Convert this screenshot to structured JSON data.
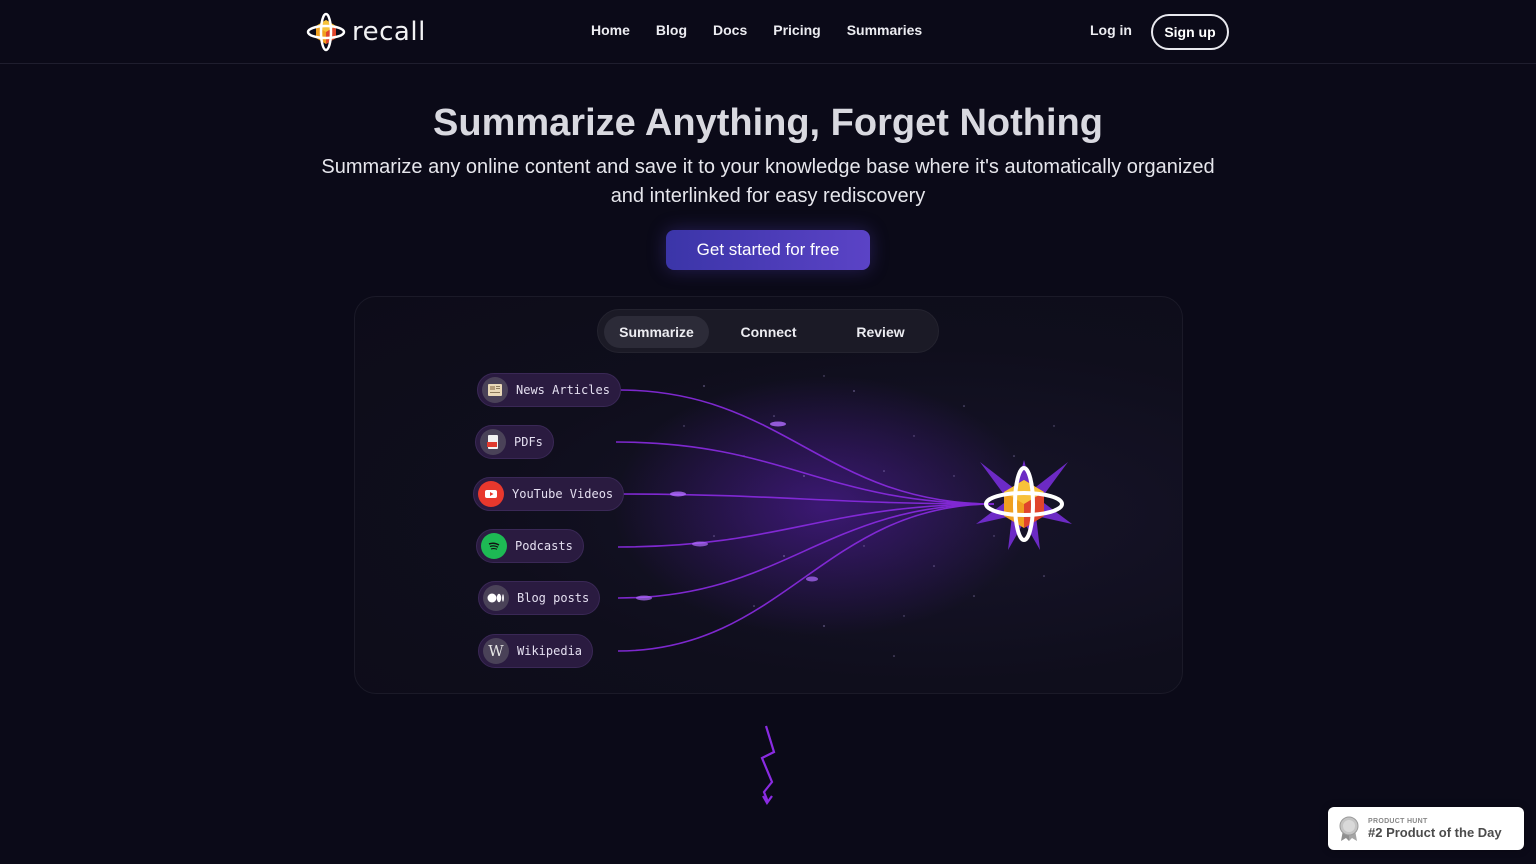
{
  "header": {
    "logo_text": "recall",
    "nav": [
      "Home",
      "Blog",
      "Docs",
      "Pricing",
      "Summaries"
    ],
    "login": "Log in",
    "signup": "Sign up"
  },
  "hero": {
    "title": "Summarize Anything, Forget Nothing",
    "subtitle": "Summarize any online content and save it to your knowledge base where it's automatically organized and interlinked for easy rediscovery",
    "cta": "Get started for free"
  },
  "demo": {
    "tabs": [
      "Summarize",
      "Connect",
      "Review"
    ],
    "active_tab": "Summarize",
    "sources": [
      {
        "label": "News Articles",
        "icon": "newspaper-icon"
      },
      {
        "label": "PDFs",
        "icon": "pdf-icon"
      },
      {
        "label": "YouTube Videos",
        "icon": "youtube-icon"
      },
      {
        "label": "Podcasts",
        "icon": "spotify-icon"
      },
      {
        "label": "Blog posts",
        "icon": "medium-icon"
      },
      {
        "label": "Wikipedia",
        "icon": "wikipedia-icon"
      }
    ]
  },
  "badge": {
    "small": "PRODUCT HUNT",
    "big": "#2 Product of the Day"
  },
  "colors": {
    "background": "#0b0a18",
    "accent": "#7b2fe0",
    "cta": "#4a3cb8"
  }
}
